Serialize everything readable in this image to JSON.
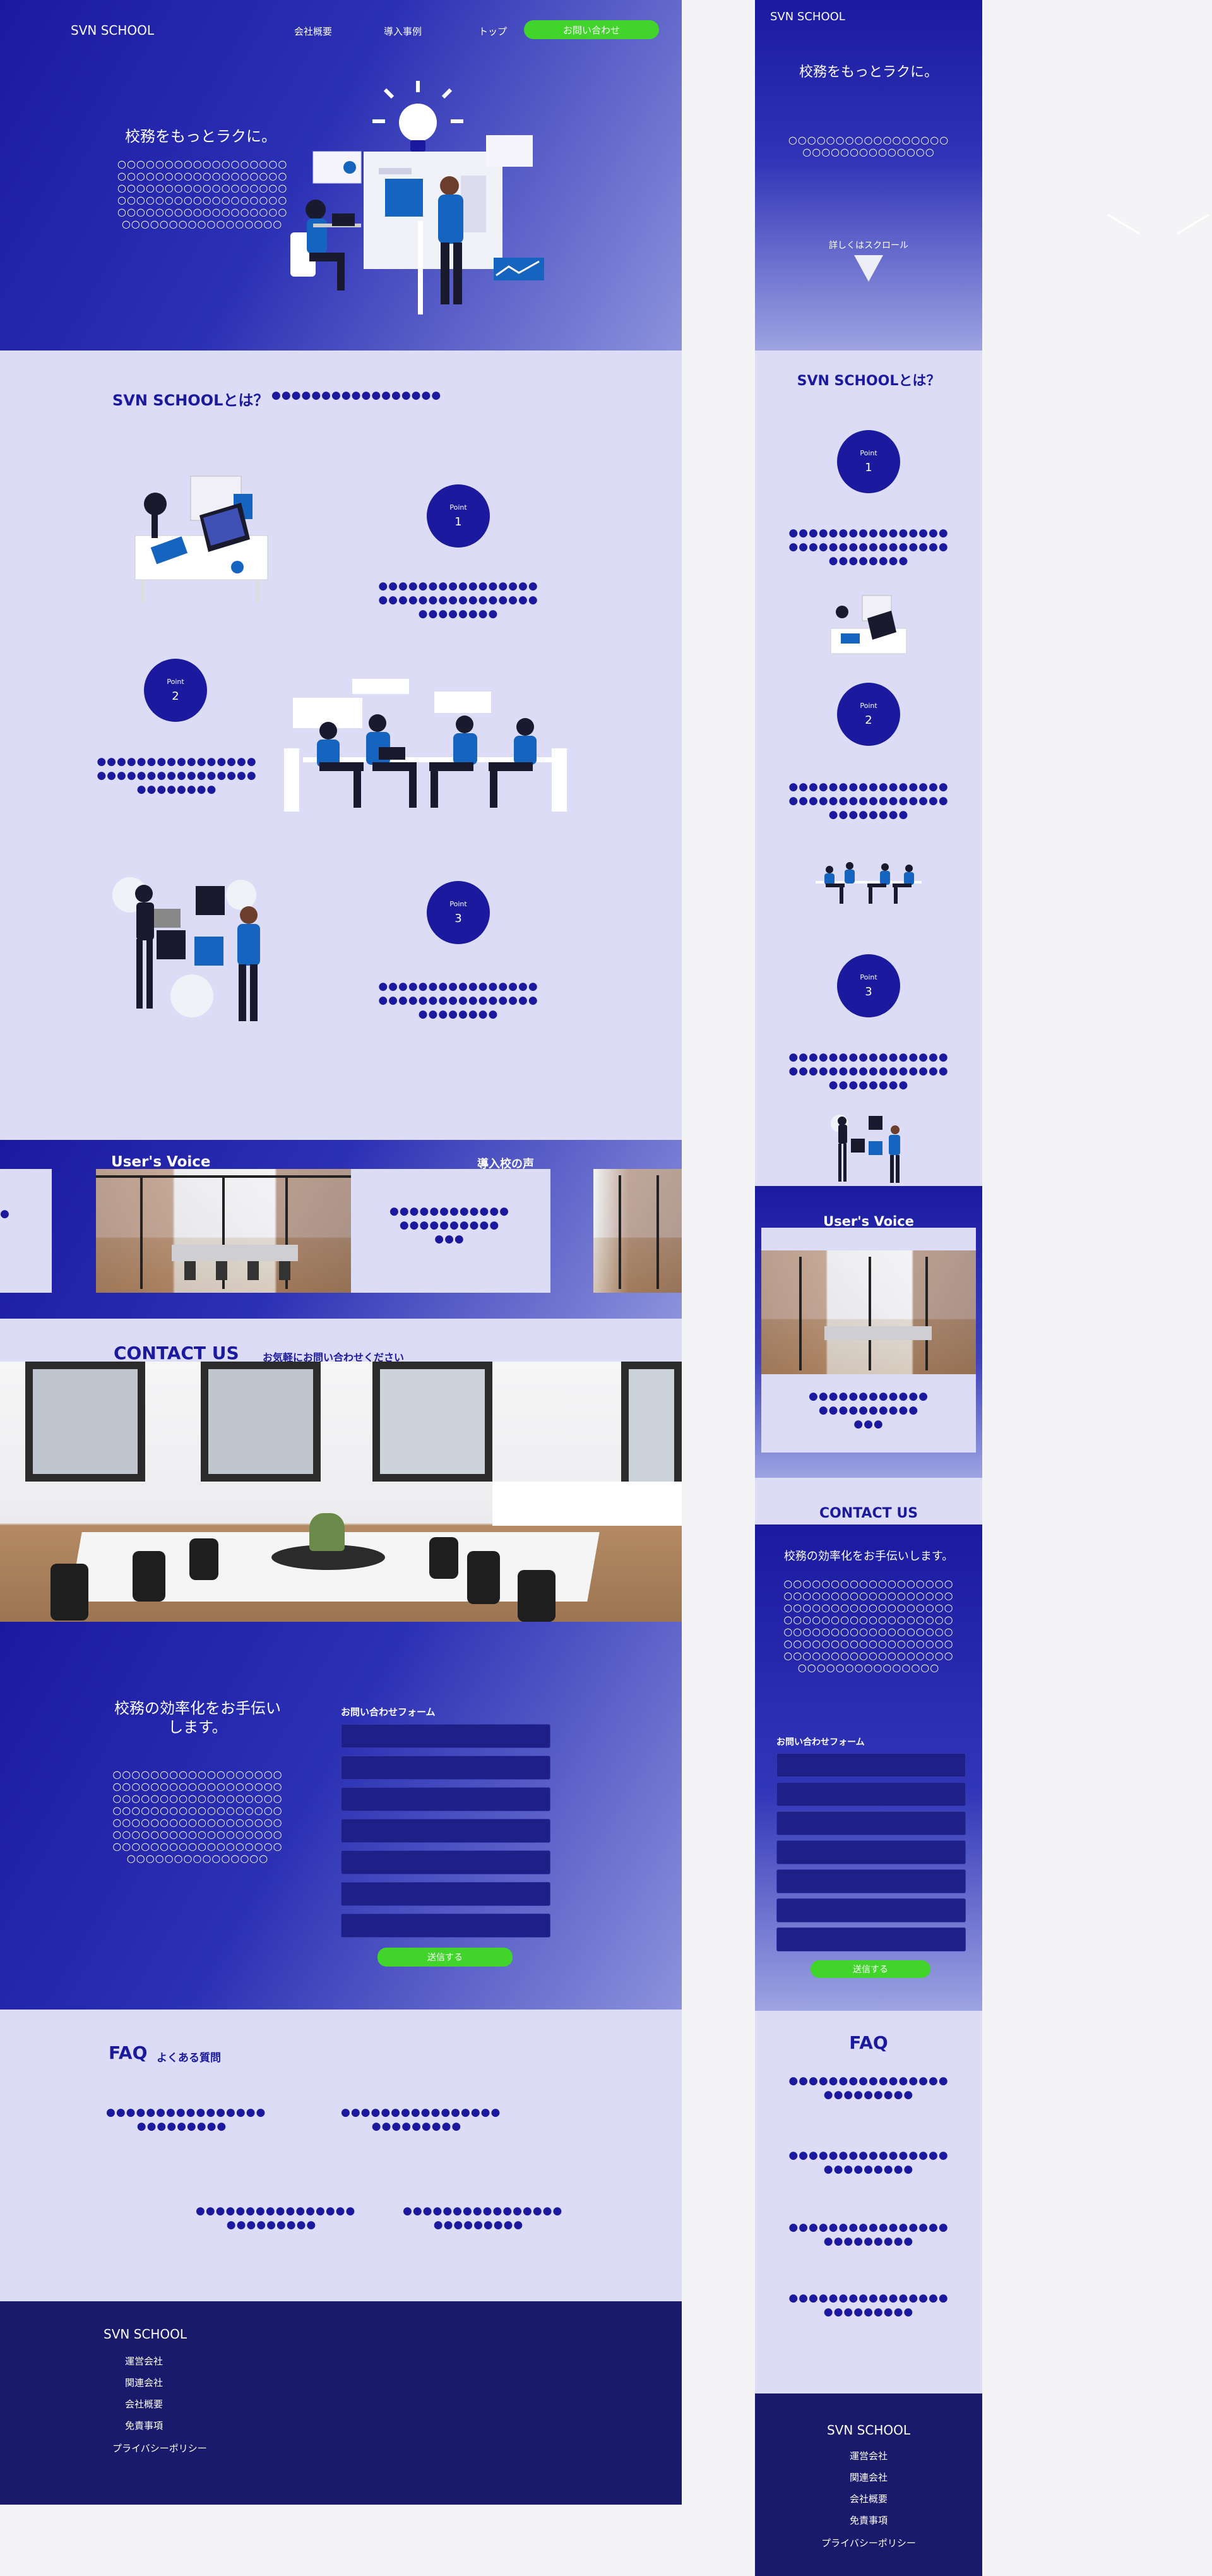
{
  "colors": {
    "brand_blue": "#1b1a9e",
    "lavender": "#dcdcf6",
    "footer_navy": "#191a6c",
    "cta_green": "#41d42a",
    "page_bg": "#f4f4f6"
  },
  "header": {
    "logo": "SVN SCHOOL",
    "nav": [
      "会社概要",
      "導入事例",
      "トップ"
    ],
    "cta": "お問い合わせ"
  },
  "hero": {
    "title": "校務をもっとラクに。",
    "body": "○○○○○○○○○○○○○○○○○○\n○○○○○○○○○○○○○○○○○○\n○○○○○○○○○○○○○○○○○○\n○○○○○○○○○○○○○○○○○○\n○○○○○○○○○○○○○○○○○○\n○○○○○○○○○○○○○○○○○",
    "illustration_icon": "lightbulb-icon"
  },
  "about": {
    "title": "SVN SCHOOLとは？",
    "subtitle": "●●●●●●●●●●●●●●●●●",
    "points": [
      {
        "label": "Point",
        "number": "1",
        "text": "●●●●●●●●●●●●●●●●\n●●●●●●●●●●●●●●●●\n●●●●●●●●"
      },
      {
        "label": "Point",
        "number": "2",
        "text": "●●●●●●●●●●●●●●●●\n●●●●●●●●●●●●●●●●\n●●●●●●●●"
      },
      {
        "label": "Point",
        "number": "3",
        "text": "●●●●●●●●●●●●●●●●\n●●●●●●●●●●●●●●●●\n●●●●●●●●"
      }
    ]
  },
  "voice": {
    "title": "User's Voice",
    "subtitle": "導入校の声",
    "card_text": "●●●●●●●●●●●●\n●●●●●●●●●●\n●●●",
    "peek_text": "●"
  },
  "contact": {
    "title": "CONTACT US",
    "subtitle": "お気軽にお問い合わせください",
    "lead": "校務の効率化をお手伝いします。",
    "body": "○○○○○○○○○○○○○○○○○○\n○○○○○○○○○○○○○○○○○○\n○○○○○○○○○○○○○○○○○○\n○○○○○○○○○○○○○○○○○○\n○○○○○○○○○○○○○○○○○○\n○○○○○○○○○○○○○○○○○○\n○○○○○○○○○○○○○○○○○○\n○○○○○○○○○○○○○○○",
    "form_title": "お問い合わせフォーム",
    "field_count_label": "",
    "submit": "送信する"
  },
  "faq": {
    "title": "FAQ",
    "subtitle": "よくある質問",
    "items": [
      "●●●●●●●●●●●●●●●●\n●●●●●●●●●",
      "●●●●●●●●●●●●●●●●\n●●●●●●●●●",
      "●●●●●●●●●●●●●●●●\n●●●●●●●●●",
      "●●●●●●●●●●●●●●●●\n●●●●●●●●●"
    ]
  },
  "footer": {
    "logo": "SVN SCHOOL",
    "links": [
      "運営会社",
      "関連会社",
      "会社概要",
      "免責事項",
      "プライバシーポリシー"
    ]
  },
  "mobile": {
    "logo": "SVN SCHOOL",
    "hero_title": "校務をもっとラクに。",
    "hero_body": "○○○○○○○○○○○○○○○○○\n○○○○○○○○○○○○○○",
    "scroll_hint": "詳しくはスクロール",
    "about_title": "SVN SCHOOLとは？",
    "voice_title": "User's Voice",
    "contact_title": "CONTACT US",
    "faq_title": "FAQ"
  }
}
